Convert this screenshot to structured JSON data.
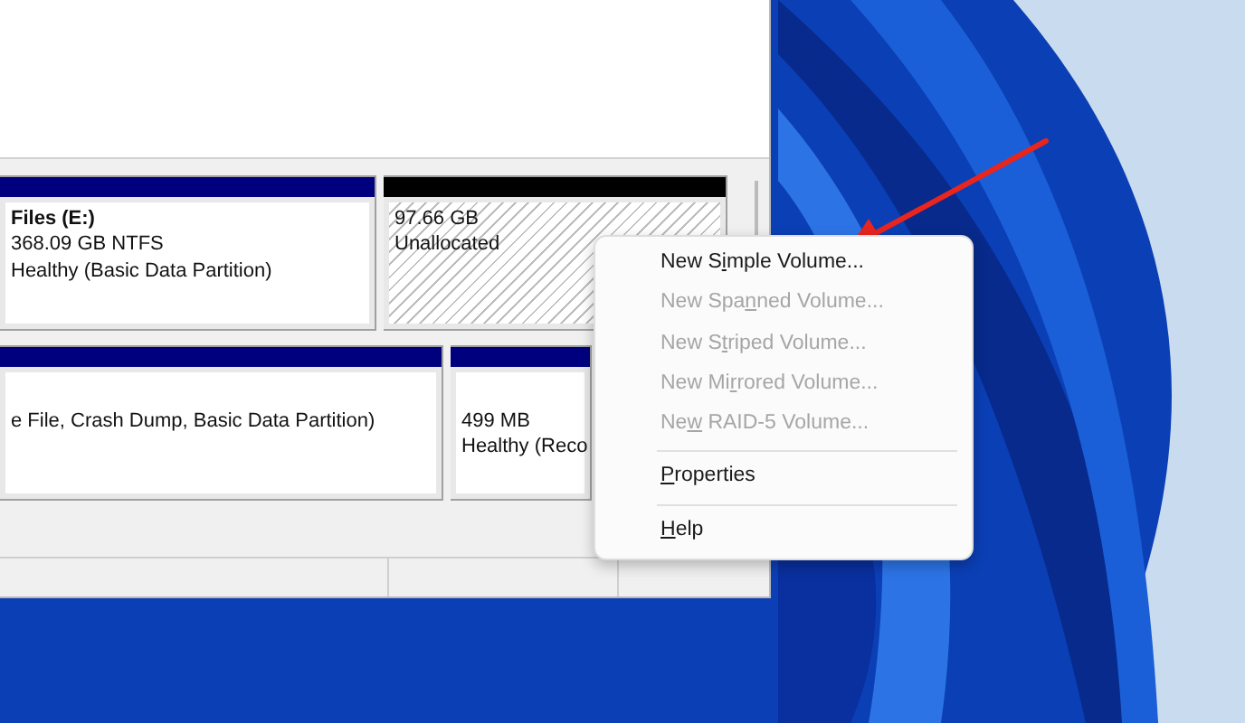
{
  "disks": [
    {
      "partitions": [
        {
          "kind": "primary",
          "title": "Files  (E:)",
          "lines": [
            "368.09 GB NTFS",
            "Healthy (Basic Data Partition)"
          ]
        },
        {
          "kind": "unallocated",
          "lines": [
            "97.66 GB",
            "Unallocated"
          ]
        }
      ]
    },
    {
      "partitions": [
        {
          "kind": "primary",
          "lines": [
            "e File, Crash Dump, Basic Data Partition)"
          ]
        },
        {
          "kind": "primary",
          "lines": [
            "499 MB",
            "Healthy (Reco"
          ]
        }
      ]
    }
  ],
  "context_menu": {
    "items": [
      {
        "kind": "item",
        "before": "New S",
        "key": "i",
        "after": "mple Volume...",
        "disabled": false
      },
      {
        "kind": "item",
        "before": "New Spa",
        "key": "n",
        "after": "ned Volume...",
        "disabled": true
      },
      {
        "kind": "item",
        "before": "New S",
        "key": "t",
        "after": "riped Volume...",
        "disabled": true
      },
      {
        "kind": "item",
        "before": "New Mi",
        "key": "r",
        "after": "rored Volume...",
        "disabled": true
      },
      {
        "kind": "item",
        "before": "Ne",
        "key": "w",
        "after": " RAID-5 Volume...",
        "disabled": true
      },
      {
        "kind": "separator"
      },
      {
        "kind": "item",
        "key": "P",
        "after": "roperties",
        "disabled": false
      },
      {
        "kind": "separator"
      },
      {
        "kind": "item",
        "key": "H",
        "after": "elp",
        "disabled": false
      }
    ]
  }
}
